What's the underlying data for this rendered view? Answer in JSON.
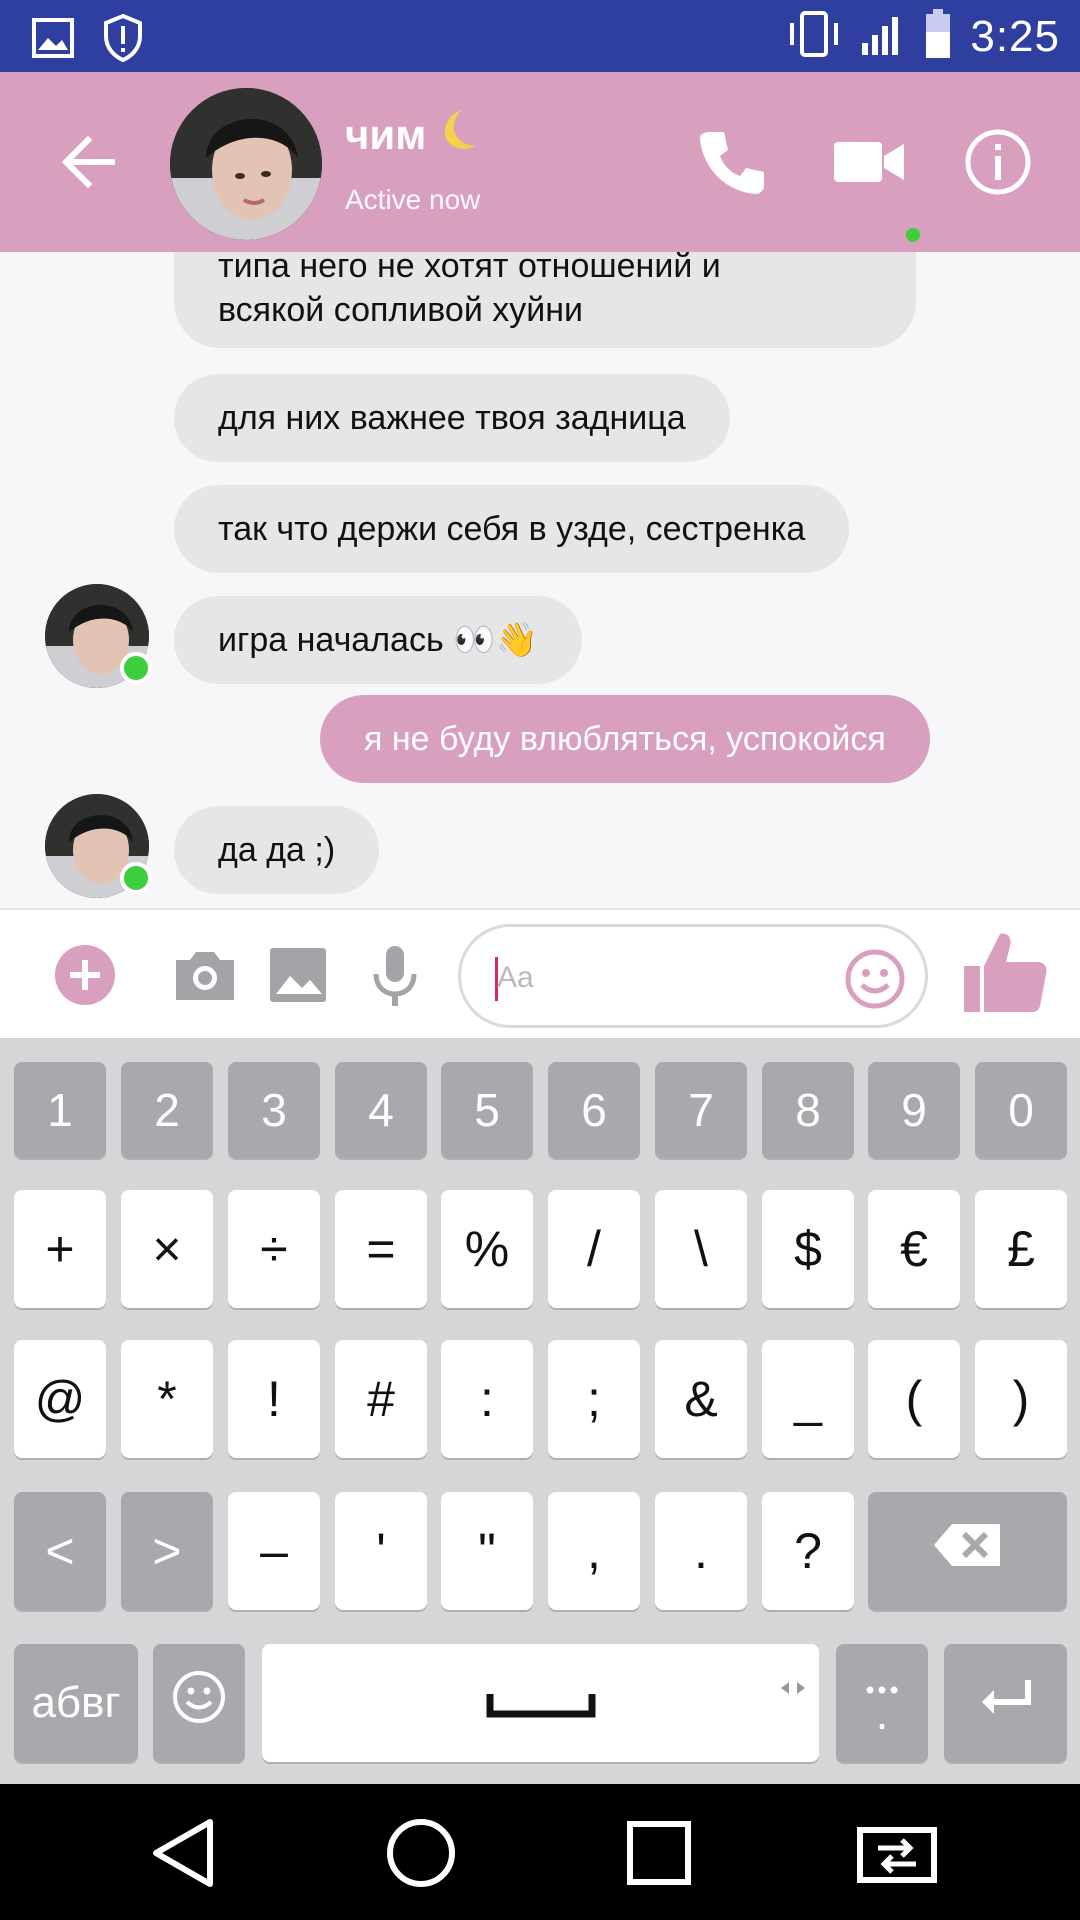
{
  "status_bar": {
    "time": "3:25",
    "left_icons": [
      "image-icon",
      "shield-alert-icon"
    ],
    "right_icons": [
      "vibrate-icon",
      "signal-icon",
      "battery-icon"
    ]
  },
  "header": {
    "contact_name": "чим",
    "name_emoji": "🌙",
    "status": "Active now",
    "icons": [
      "back-arrow-icon",
      "phone-icon",
      "video-camera-icon",
      "info-icon"
    ]
  },
  "messages": [
    {
      "from": "them",
      "text_lines": [
        "типа него не хотят отношений и",
        "всякой сопливой хуйни"
      ]
    },
    {
      "from": "them",
      "text": "для них важнее твоя задница"
    },
    {
      "from": "them",
      "text": "так что держи себя в узде, сестренка"
    },
    {
      "from": "them",
      "text": "игра началась 👀👋"
    },
    {
      "from": "me",
      "text": "я не буду влюбляться, успокойся"
    },
    {
      "from": "them",
      "text": "да да ;)"
    }
  ],
  "composer": {
    "placeholder": "Aa",
    "icons": [
      "plus-icon",
      "camera-icon",
      "gallery-icon",
      "microphone-icon",
      "smiley-icon",
      "thumbs-up-icon"
    ]
  },
  "keyboard": {
    "row1": [
      "1",
      "2",
      "3",
      "4",
      "5",
      "6",
      "7",
      "8",
      "9",
      "0"
    ],
    "row2": [
      "+",
      "×",
      "÷",
      "=",
      "%",
      "/",
      "\\",
      "$",
      "€",
      "£"
    ],
    "row3": [
      "@",
      "*",
      "!",
      "#",
      ":",
      ";",
      "&",
      "_",
      "(",
      ")"
    ],
    "row4": [
      "<",
      ">",
      "–",
      "'",
      "\"",
      ",",
      ".",
      "?"
    ],
    "lang_key": "абвг",
    "period_key": "."
  },
  "colors": {
    "accent": "#d99fbf",
    "status_bar": "#2f3f9f",
    "online": "#3ecf3e"
  }
}
